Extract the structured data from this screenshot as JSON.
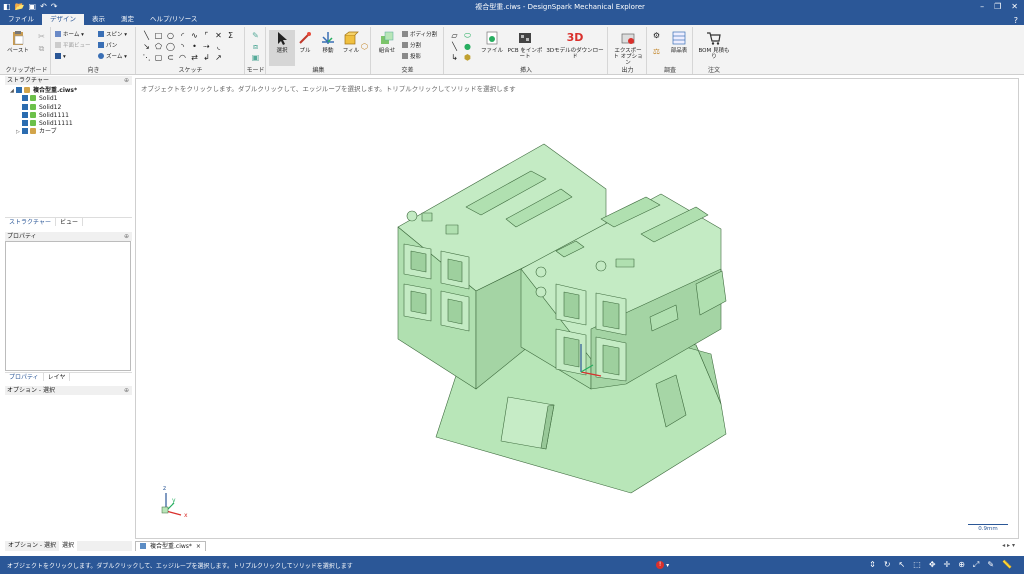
{
  "window": {
    "title": "複合型重.ciws - DesignSpark Mechanical Explorer"
  },
  "menu": {
    "tabs": [
      "ファイル",
      "デザイン",
      "表示",
      "測定",
      "ヘルプ/リソース"
    ],
    "active": "デザイン"
  },
  "ribbon": {
    "clipboard": {
      "label": "クリップボード",
      "paste": "ペースト"
    },
    "orient": {
      "label": "向き",
      "home": "ホーム",
      "plan_view": "平面ビュー",
      "spin": "スピン",
      "pan": "パン",
      "zoom": "ズーム"
    },
    "sketch": {
      "label": "スケッチ"
    },
    "mode": {
      "label": "モード"
    },
    "edit": {
      "label": "編集",
      "select": "選択",
      "pull": "プル",
      "move": "移動",
      "fill": "フィル"
    },
    "intersect": {
      "label": "交差",
      "combine": "組合せ",
      "split_body": "ボディ分割",
      "split": "分割",
      "project": "投影"
    },
    "insert": {
      "label": "挿入",
      "file": "ファイル",
      "pcb": "PCB をインポート",
      "download_3d": "3Dモデルのダウンロード",
      "badge_3d": "3D"
    },
    "output": {
      "label": "出力",
      "export": "エクスポート オプション"
    },
    "investigate": {
      "label": "調査",
      "parts_table": "部品表"
    },
    "order": {
      "label": "注文",
      "bom": "BOM 見積もり"
    }
  },
  "structure": {
    "title": "ストラクチャー",
    "root": "複合型重.ciws*",
    "items": [
      "Solid1",
      "Solid12",
      "Solid1111",
      "Solid11111",
      "カーブ"
    ]
  },
  "panel_tabs": {
    "structure": "ストラクチャー",
    "view": "ビュー"
  },
  "properties": {
    "title": "プロパティ",
    "tab_properties": "プロパティ",
    "tab_layers": "レイヤ"
  },
  "options": {
    "title": "オプション - 選択"
  },
  "bottom_tabs": {
    "options": "オプション - 選択",
    "select": "選択"
  },
  "viewport": {
    "hint": "オブジェクトをクリックします。ダブルクリックして、エッジループを選択します。トリプルクリックしてソリッドを選択します",
    "scale": "0.9mm",
    "model_color": "#b8e6b8",
    "axis": {
      "z": "z",
      "y": "y",
      "x": "x"
    }
  },
  "doc_tab": {
    "name": "複合型重.ciws*",
    "close": "×"
  },
  "status": {
    "message": "オブジェクトをクリックします。ダブルクリックして、エッジループを選択します。トリプルクリックしてソリッドを選択します",
    "error_count": "!"
  },
  "colors": {
    "brand": "#2b5797",
    "ribbon": "#f3f3f3",
    "model": "#b8e6b8"
  }
}
